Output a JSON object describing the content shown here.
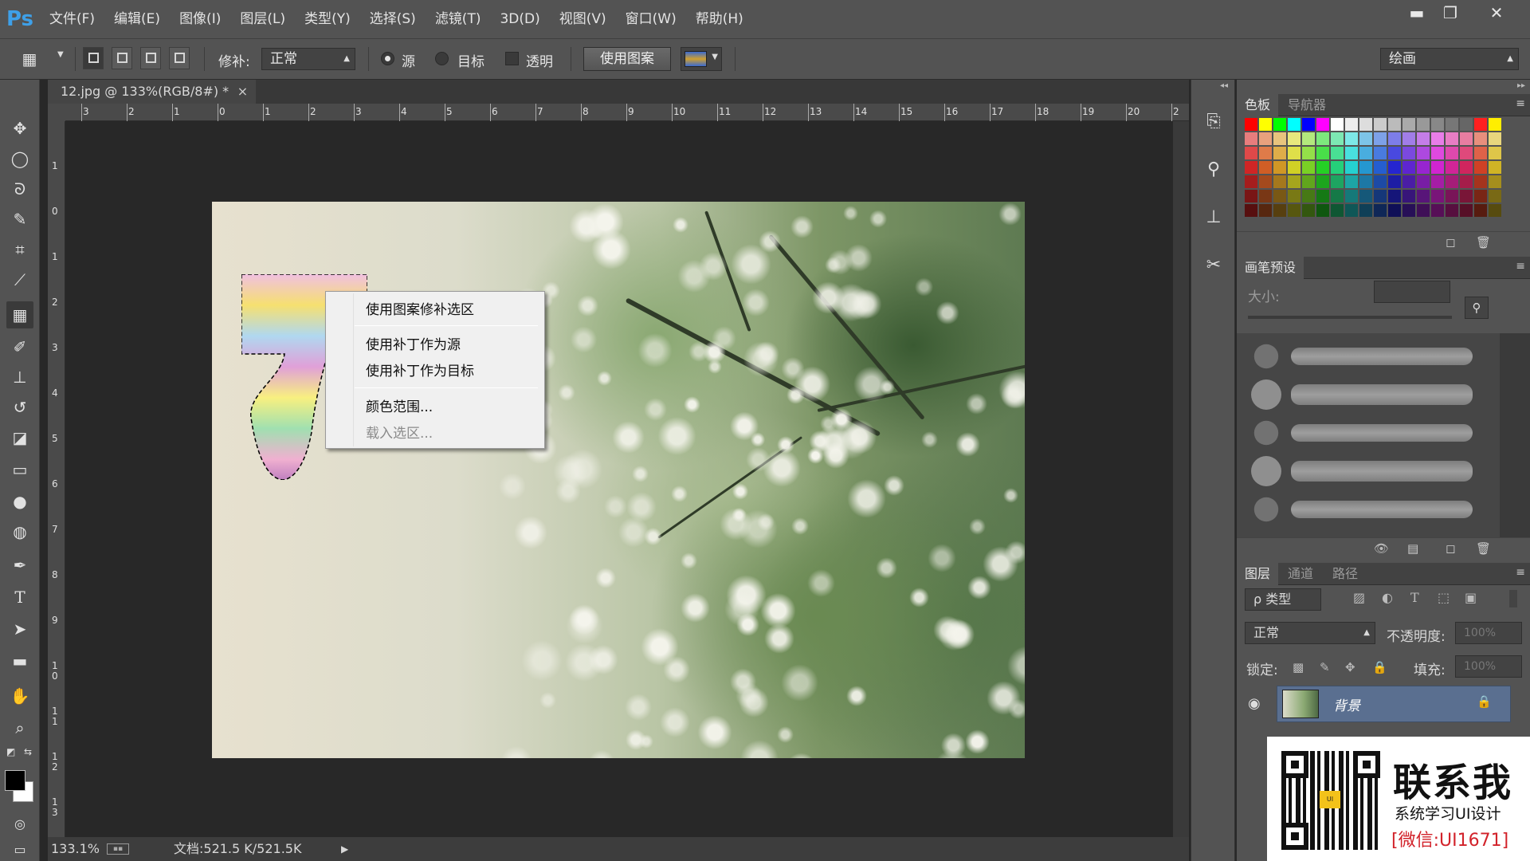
{
  "app": {
    "logo": "Ps"
  },
  "menus": [
    "文件(F)",
    "编辑(E)",
    "图像(I)",
    "图层(L)",
    "类型(Y)",
    "选择(S)",
    "滤镜(T)",
    "3D(D)",
    "视图(V)",
    "窗口(W)",
    "帮助(H)"
  ],
  "window_controls": {
    "minimize": "▬",
    "maximize": "❐",
    "close": "✕"
  },
  "options": {
    "patch_label": "修补:",
    "patch_mode": "正常",
    "source_label": "源",
    "target_label": "目标",
    "transparent_label": "透明",
    "use_pattern_button": "使用图案",
    "workspace": "绘画"
  },
  "document": {
    "tab_title": "12.jpg @ 133%(RGB/8#) *",
    "tab_close": "×",
    "ruler_top": [
      "3",
      "2",
      "1",
      "0",
      "1",
      "2",
      "3",
      "4",
      "5",
      "6",
      "7",
      "8",
      "9",
      "10",
      "11",
      "12",
      "13",
      "14",
      "15",
      "16",
      "17",
      "18",
      "19",
      "20",
      "2"
    ],
    "ruler_left": [
      "1",
      "0",
      "1",
      "2",
      "3",
      "4",
      "5",
      "6",
      "7",
      "8",
      "9",
      "1 0",
      "1 1",
      "1 2",
      "1 3"
    ]
  },
  "context_menu": {
    "items": [
      {
        "label": "使用图案修补选区",
        "enabled": true
      },
      {
        "label": "使用补丁作为源",
        "enabled": true
      },
      {
        "label": "使用补丁作为目标",
        "enabled": true
      },
      {
        "label": "颜色范围...",
        "enabled": true
      },
      {
        "label": "载入选区...",
        "enabled": false
      }
    ]
  },
  "status": {
    "zoom": "133.1%",
    "doc_info": "文档:521.5 K/521.5K",
    "arrow": "▶"
  },
  "swatches_panel": {
    "tabs": [
      "色板",
      "导航器"
    ]
  },
  "brush_presets_panel": {
    "tab": "画笔预设",
    "size_label": "大小:"
  },
  "layers_panel": {
    "tabs": [
      "图层",
      "通道",
      "路径"
    ],
    "filter_type": "ρ 类型",
    "blend_mode": "正常",
    "opacity_label": "不透明度:",
    "opacity_value": "100%",
    "lock_label": "锁定:",
    "fill_label": "填充:",
    "fill_value": "100%",
    "layers": [
      {
        "name": "背景",
        "visible": true,
        "locked": true
      }
    ]
  },
  "watermark": {
    "title": "联系我",
    "subtitle": "系统学习UI设计",
    "contact": "[微信:UI1671]",
    "qr_badge": "UI"
  },
  "colors": {
    "accent_ps": "#3ea0e8",
    "panel": "#535353",
    "canvas_bg": "#282828",
    "layer_selected": "#5a6f90",
    "watermark_red": "#d2222a"
  }
}
